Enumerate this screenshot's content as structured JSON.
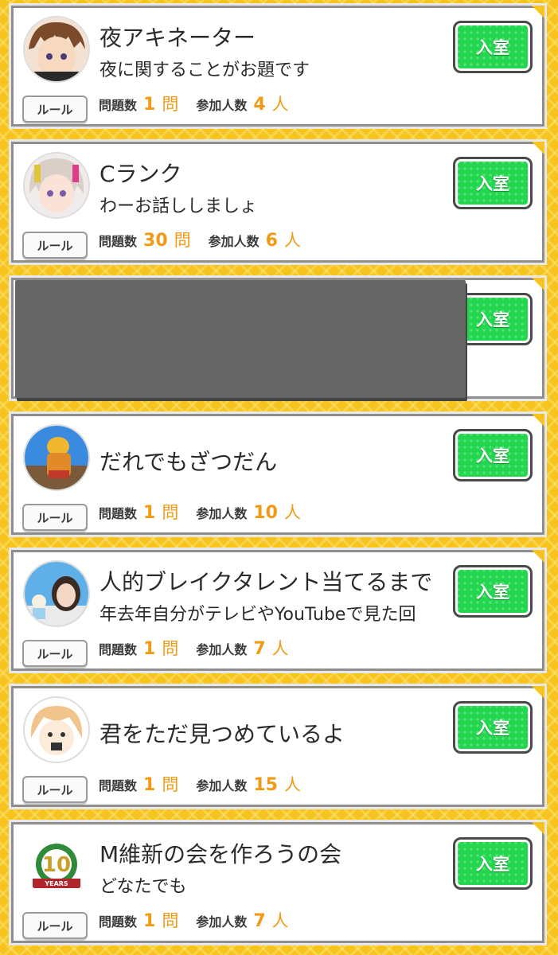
{
  "common": {
    "rule_label": "ルール",
    "questions_label": "問題数",
    "questions_unit": "問",
    "participants_label": "参加人数",
    "participants_unit": "人",
    "enter_label": "入室"
  },
  "rooms": [
    {
      "title": "夜アキネーター",
      "desc": "夜に関することがお題です",
      "questions": "1",
      "participants": "4"
    },
    {
      "title": "Cランク",
      "desc": "わーお話ししましょ",
      "questions": "30",
      "participants": "6"
    },
    {
      "title": "",
      "desc": "",
      "questions": "",
      "participants": ""
    },
    {
      "title": "だれでもざつだん",
      "desc": "",
      "questions": "1",
      "participants": "10"
    },
    {
      "title": "人的ブレイクタレント当てるまで",
      "desc": "年去年自分がテレビやYouTubeで見た回",
      "questions": "1",
      "participants": "7"
    },
    {
      "title": "君をただ見つめているよ",
      "desc": "",
      "questions": "1",
      "participants": "15"
    },
    {
      "title": "M維新の会を作ろうの会",
      "desc": "どなたでも",
      "questions": "1",
      "participants": "7"
    }
  ],
  "avatar_badge_text": "10 YEARS GREEN",
  "colors": {
    "background": "#f7c41f",
    "enter_button": "#22d64e",
    "accent_number": "#f29a14",
    "redaction": "#666666"
  }
}
